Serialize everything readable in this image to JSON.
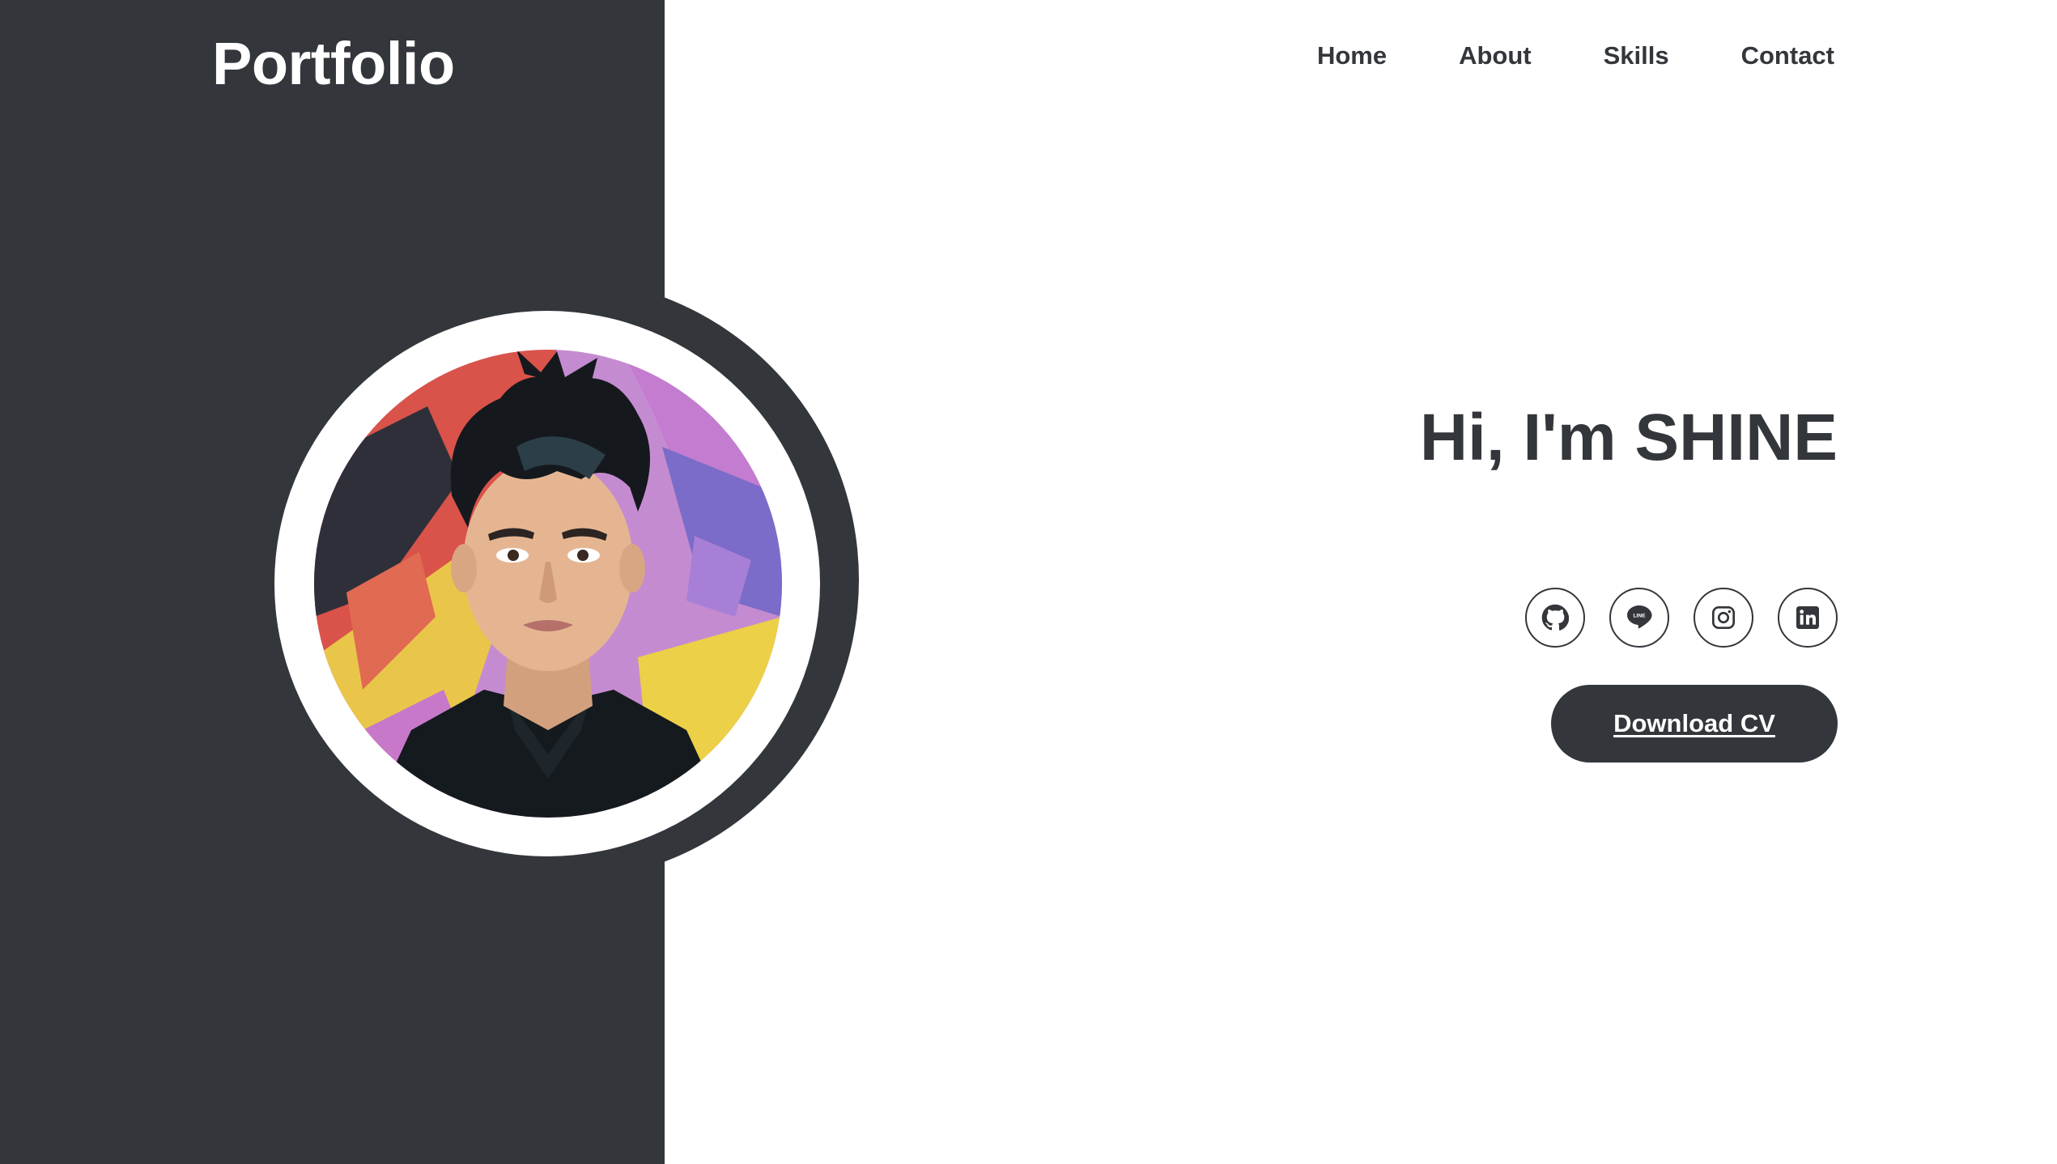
{
  "brand": {
    "title": "Portfolio"
  },
  "nav": {
    "items": [
      {
        "label": "Home"
      },
      {
        "label": "About"
      },
      {
        "label": "Skills"
      },
      {
        "label": "Contact"
      }
    ]
  },
  "hero": {
    "title": "Hi, I'm SHINE",
    "cv_button_label": "Download CV"
  },
  "socials": [
    {
      "icon": "github-icon"
    },
    {
      "icon": "line-icon",
      "glyph_text": "LINE"
    },
    {
      "icon": "instagram-icon"
    },
    {
      "icon": "linkedin-icon"
    }
  ],
  "colors": {
    "dark": "#33363b",
    "background": "#ffffff",
    "accent_red": "#e0504a",
    "accent_purple": "#b57bd0",
    "accent_yellow": "#eccc45"
  }
}
